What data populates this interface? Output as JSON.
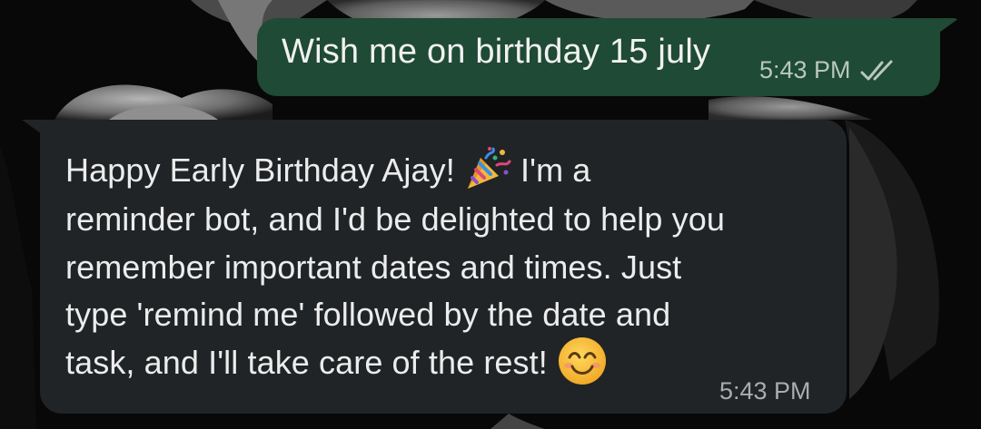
{
  "chat": {
    "outgoing": {
      "text": "Wish me on birthday 15 july",
      "time": "5:43 PM",
      "status_icon": "double-check-icon"
    },
    "incoming": {
      "line1_a": "Happy Early Birthday Ajay!",
      "line1_emoji": "party-popper-icon",
      "line1_b": "I'm a",
      "line2": "reminder bot, and I'd be delighted to help you",
      "line3": "remember important dates and times. Just",
      "line4": "type 'remind me' followed by the date and",
      "line5": "task, and I'll take care of the rest!",
      "line5_emoji": "smiling-face-icon",
      "time": "5:43 PM"
    }
  },
  "colors": {
    "outgoing_bubble": "#1f4a35",
    "incoming_bubble": "#202426",
    "background": "#0a0a0a"
  }
}
